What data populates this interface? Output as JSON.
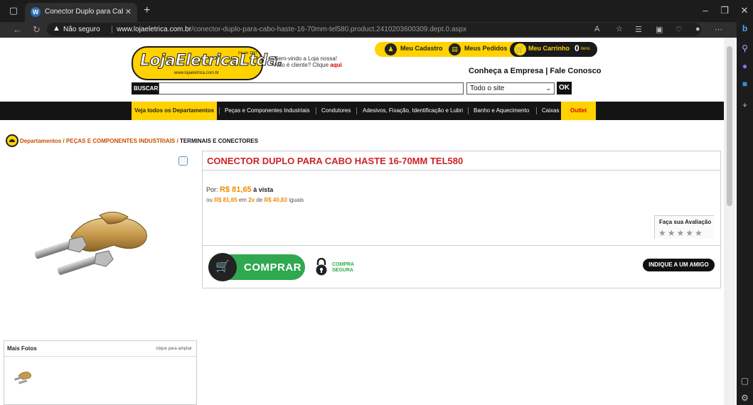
{
  "browser": {
    "tab_title": "Conector Duplo para Cabo Haste",
    "security_label": "Não seguro",
    "url_domain": "www.lojaeletrica.com.br",
    "url_path": "/conector-duplo-para-cabo-haste-16-70mm-tel580.product.2410203600309.dept.0.aspx"
  },
  "header": {
    "logo_name": "LojaEletricaLtda.",
    "logo_sub": "www.lojaeletrica.com.br",
    "logo_since": "Desde 1967",
    "welcome_line1": "Bem-vindo a Loja nossa!",
    "welcome_line2": "Não é cliente? Clique",
    "welcome_link": "aqui",
    "nav": {
      "account": "Meu Cadastro",
      "orders": "Meus Pedidos",
      "cart": "Meu Carrinho",
      "cart_count": "0",
      "cart_unit": "itens"
    },
    "company_links": "Conheça a Empresa | Fale Conosco"
  },
  "search": {
    "label": "BUSCAR:",
    "placeholder": "",
    "scope": "Todo o site",
    "button": "OK"
  },
  "departments": [
    "Veja todos os Departamentos",
    "Peças e Componentes Industriais",
    "Condutores",
    "Adesivos, Fixação, Identificação e Lubri",
    "Banho e Aquecimento",
    "Caixas",
    "Outlet"
  ],
  "breadcrumb": {
    "part1": "Departamentos / PEÇAS E COMPONENTES INDUSTRIAIS /",
    "part2": "TERMINAIS E CONECTORES"
  },
  "product": {
    "title": "CONECTOR DUPLO PARA CABO HASTE 16-70MM TEL580",
    "price_prefix": "Por:",
    "price": "R$ 81,65",
    "price_suffix": "à vista",
    "inst_prefix": "ou",
    "inst_total": "R$ 81,65",
    "inst_mid1": "em",
    "inst_count": "2x",
    "inst_mid2": "de",
    "inst_value": "R$ 40,83",
    "inst_suffix": "iguais",
    "rating_label": "Faça sua Avaliação",
    "rating_value": 0,
    "rating_max": 5,
    "buy_button": "COMPRAR",
    "secure_line1": "COMPRA",
    "secure_line2": "SEGURA",
    "recommend_button": "INDIQUE A UM AMIGO"
  },
  "gallery": {
    "title": "Mais Fotos",
    "hint": "clique para ampliar"
  },
  "colors": {
    "brand_yellow": "#ffd200",
    "price_orange": "#f08a00",
    "title_red": "#cc2222",
    "buy_green": "#2fa84f"
  }
}
